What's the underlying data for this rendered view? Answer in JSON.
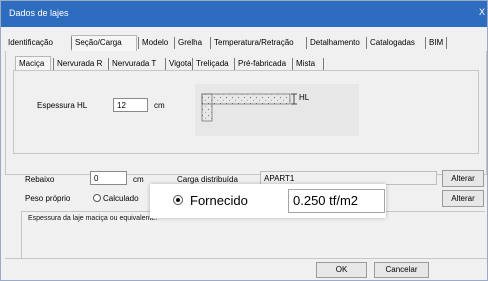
{
  "window": {
    "title": "Dados de lajes",
    "close_glyph": "X"
  },
  "tabs_main": [
    "Identificação",
    "Seção/Carga",
    "Modelo",
    "Grelha",
    "Temperatura/Retração",
    "Detalhamento",
    "Catalogadas",
    "BIM"
  ],
  "tabs_section": [
    "Maciça",
    "Nervurada R",
    "Nervurada T",
    "Vigota",
    "Treliçada",
    "Pré-fabricada",
    "Mista"
  ],
  "thickness": {
    "label": "Espessura HL",
    "value": "12",
    "unit": "cm"
  },
  "preview": {
    "dimension_label": "HL"
  },
  "rebaixo": {
    "label": "Rebaixo",
    "value": "0",
    "unit": "cm"
  },
  "carga": {
    "label": "Carga distribuída",
    "value": "APART1",
    "button": "Alterar"
  },
  "peso_proprio": {
    "label": "Peso próprio",
    "option_calculado": "Calculado",
    "option_fornecido": "Fornecido",
    "value": "0.250 tf/m2",
    "button": "Alterar"
  },
  "description": "Espessura da laje maciça ou equivalente.",
  "buttons": {
    "ok": "OK",
    "cancel": "Cancelar"
  }
}
